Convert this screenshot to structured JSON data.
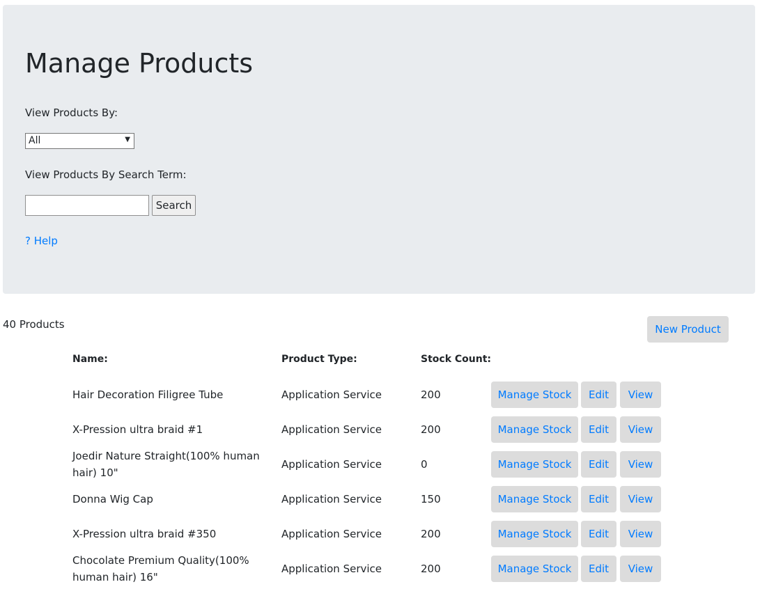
{
  "header": {
    "title": "Manage Products",
    "view_by_label": "View Products By:",
    "view_by_selected": "All",
    "search_label": "View Products By Search Term:",
    "search_value": "",
    "search_button": "Search",
    "help_link": "? Help"
  },
  "summary": {
    "count_text": "40 Products",
    "new_product_button": "New Product"
  },
  "table": {
    "columns": [
      "Name:",
      "Product Type:",
      "Stock Count:"
    ],
    "rows": [
      {
        "name": "Hair Decoration Filigree Tube",
        "type": "Application Service",
        "stock": "200"
      },
      {
        "name": "X-Pression ultra braid #1",
        "type": "Application Service",
        "stock": "200"
      },
      {
        "name": "Joedir Nature Straight(100% human hair) 10\"",
        "type": "Application Service",
        "stock": "0"
      },
      {
        "name": "Donna Wig Cap",
        "type": "Application Service",
        "stock": "150"
      },
      {
        "name": "X-Pression ultra braid #350",
        "type": "Application Service",
        "stock": "200"
      },
      {
        "name": "Chocolate Premium Quality(100% human hair) 16\"",
        "type": "Application Service",
        "stock": "200"
      }
    ],
    "actions": {
      "manage": "Manage Stock",
      "edit": "Edit",
      "view": "View"
    }
  },
  "colors": {
    "link": "#007bff",
    "panel_bg": "#e9ecef",
    "button_bg": "#dcdcdc"
  }
}
